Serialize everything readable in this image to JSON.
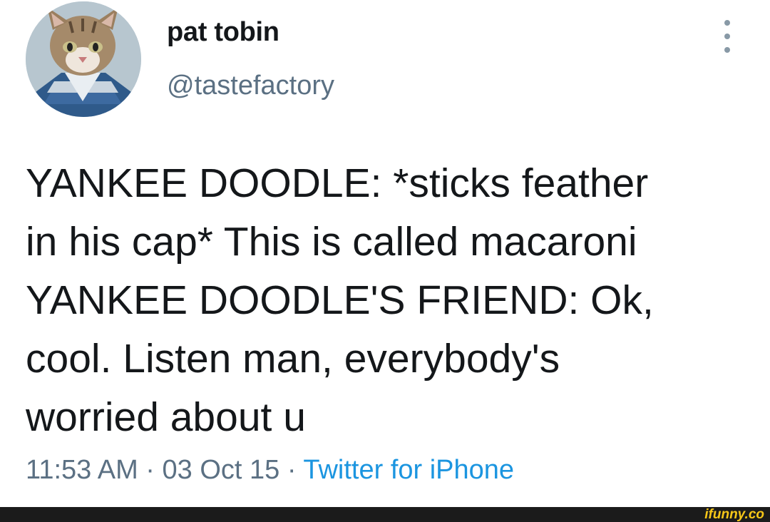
{
  "tweet": {
    "display_name": "pat tobin",
    "handle": "@tastefactory",
    "text": "YANKEE DOODLE: *sticks feather\nin his cap* This is called macaroni\nYANKEE DOODLE'S FRIEND: Ok,\ncool. Listen man, everybody's\nworried about u",
    "time": "11:53 AM",
    "separator": " · ",
    "date": "03 Oct 15",
    "source": "Twitter for iPhone"
  },
  "watermark": "ifunny.co",
  "colors": {
    "name": "#14171a",
    "secondary": "#5b7083",
    "link": "#1b95e0",
    "watermark": "#f7c718"
  }
}
